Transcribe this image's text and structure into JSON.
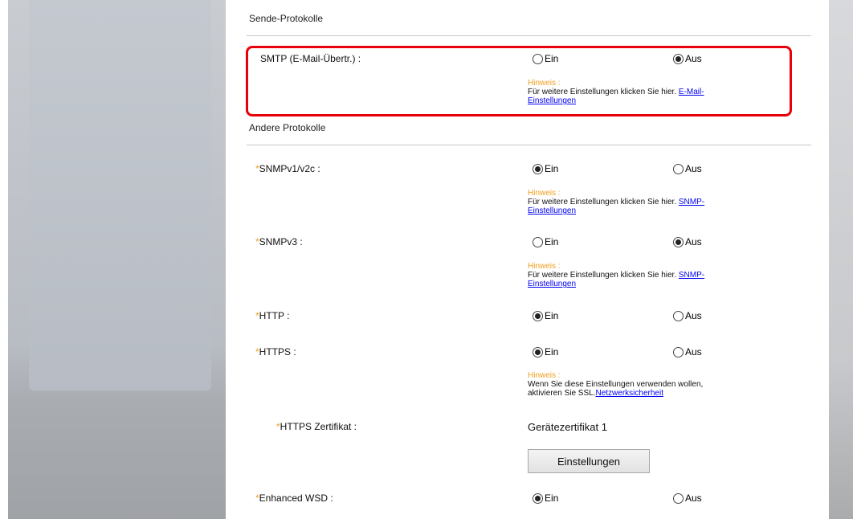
{
  "sections": {
    "send_protocols": "Sende-Protokolle",
    "other_protocols": "Andere Protokolle"
  },
  "option_on": "Ein",
  "option_off": "Aus",
  "required_marker": "*",
  "hint_title": "Hinweis :",
  "smtp": {
    "label": "SMTP (E-Mail-Übertr.) :",
    "selected": "Aus",
    "hint_text": "Für weitere Einstellungen klicken Sie hier.",
    "hint_link_1": "E-Mail-",
    "hint_link_2": "Einstellungen"
  },
  "snmpv1": {
    "label": "SNMPv1/v2c :",
    "selected": "Ein",
    "hint_text": "Für weitere Einstellungen klicken Sie hier.",
    "hint_link_1": "SNMP-",
    "hint_link_2": "Einstellungen"
  },
  "snmpv3": {
    "label": "SNMPv3 :",
    "selected": "Aus",
    "hint_text": "Für weitere Einstellungen klicken Sie hier.",
    "hint_link_1": "SNMP-",
    "hint_link_2": "Einstellungen"
  },
  "http": {
    "label": "HTTP :",
    "selected": "Ein"
  },
  "https": {
    "label": "HTTPS :",
    "selected": "Ein",
    "hint_line1": "Wenn Sie diese Einstellungen verwenden wollen,",
    "hint_line2": "aktivieren Sie SSL.",
    "hint_link": "Netzwerksicherheit"
  },
  "https_cert": {
    "label": "HTTPS Zertifikat :",
    "value": "Gerätezertifikat 1",
    "button": "Einstellungen"
  },
  "wsd": {
    "label": "Enhanced WSD :",
    "selected": "Ein"
  },
  "colors": {
    "highlight": "#e8000b",
    "hint_title": "#f0a020",
    "link": "#0000ee",
    "required": "#f0a020"
  }
}
